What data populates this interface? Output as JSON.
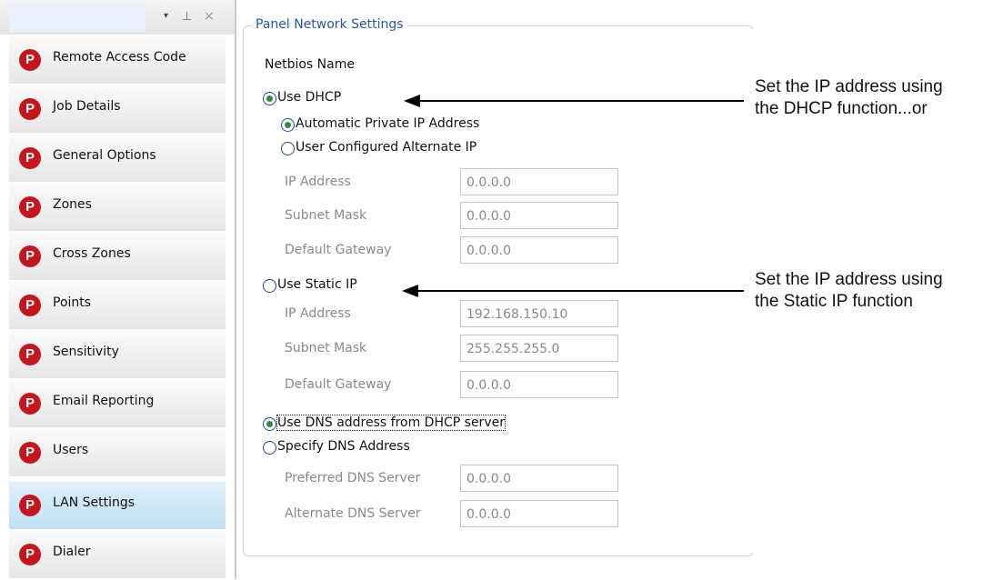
{
  "sidebar": {
    "header": {
      "pin_glyph": "⊥",
      "close_glyph": "×",
      "dropdown_glyph": "▾"
    },
    "items": [
      {
        "label": "Remote Access Code",
        "icon": "P"
      },
      {
        "label": "Job Details",
        "icon": "P"
      },
      {
        "label": "General Options",
        "icon": "P"
      },
      {
        "label": "Zones",
        "icon": "P"
      },
      {
        "label": "Cross Zones",
        "icon": "P"
      },
      {
        "label": "Points",
        "icon": "P"
      },
      {
        "label": "Sensitivity",
        "icon": "P"
      },
      {
        "label": "Email Reporting",
        "icon": "P"
      },
      {
        "label": "Users",
        "icon": "P"
      },
      {
        "label": "LAN Settings",
        "icon": "P",
        "active": true
      },
      {
        "label": "Dialer",
        "icon": "P"
      }
    ]
  },
  "panel": {
    "title": "Panel Network Settings",
    "netbios_label": "Netbios Name",
    "dhcp": {
      "label": "Use DHCP",
      "selected": true,
      "auto_private_label": "Automatic Private IP Address",
      "auto_private_selected": true,
      "user_alternate_label": "User Configured Alternate IP",
      "user_alternate_selected": false,
      "ip_label": "IP Address",
      "ip_value": "0.0.0.0",
      "subnet_label": "Subnet Mask",
      "subnet_value": "0.0.0.0",
      "gateway_label": "Default Gateway",
      "gateway_value": "0.0.0.0"
    },
    "static": {
      "label": "Use Static IP",
      "selected": false,
      "ip_label": "IP Address",
      "ip_value": "192.168.150.10",
      "subnet_label": "Subnet Mask",
      "subnet_value": "255.255.255.0",
      "gateway_label": "Default Gateway",
      "gateway_value": "0.0.0.0"
    },
    "dns": {
      "dhcp_label": "Use DNS address from DHCP server",
      "dhcp_selected": true,
      "specify_label": "Specify DNS Address",
      "specify_selected": false,
      "preferred_label": "Preferred DNS Server",
      "preferred_value": "0.0.0.0",
      "alternate_label": "Alternate DNS Server",
      "alternate_value": "0.0.0.0"
    }
  },
  "annotations": {
    "dhcp_line1": "Set the IP address using",
    "dhcp_line2": "the DHCP function...or",
    "static_line1": "Set the IP address using",
    "static_line2": "the Static IP function"
  },
  "colors": {
    "brand_red": "#c4161c",
    "selected_green": "#2e8a44",
    "title_blue": "#2a56a8",
    "active_item": "#c9e6f7"
  }
}
